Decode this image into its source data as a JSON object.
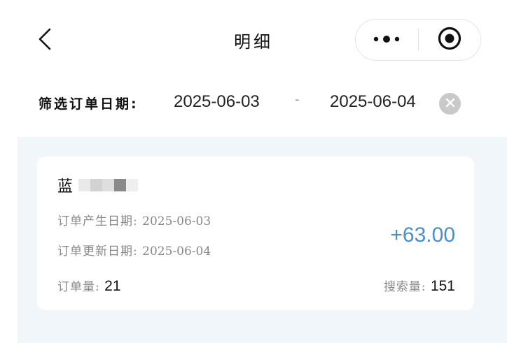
{
  "navbar": {
    "title": "明细",
    "back_icon": "chevron-left-icon",
    "more_icon": "more-dots-icon",
    "target_icon": "target-circle-icon"
  },
  "filter": {
    "label": "筛选订单日期:",
    "start_date": "2025-06-03",
    "separator": "-",
    "end_date": "2025-06-04",
    "clear_icon": "clear-x-icon"
  },
  "record": {
    "name": "蓝",
    "created_label": "订单产生日期:",
    "created_value": "2025-06-03",
    "updated_label": "订单更新日期:",
    "updated_value": "2025-06-04",
    "amount": "+63.00",
    "orders_label": "订单量:",
    "orders_value": "21",
    "search_label": "搜索量:",
    "search_value": "151"
  },
  "colors": {
    "accent": "#4a8fcd",
    "list_background": "#f1f6fa",
    "muted_text": "#888888"
  }
}
